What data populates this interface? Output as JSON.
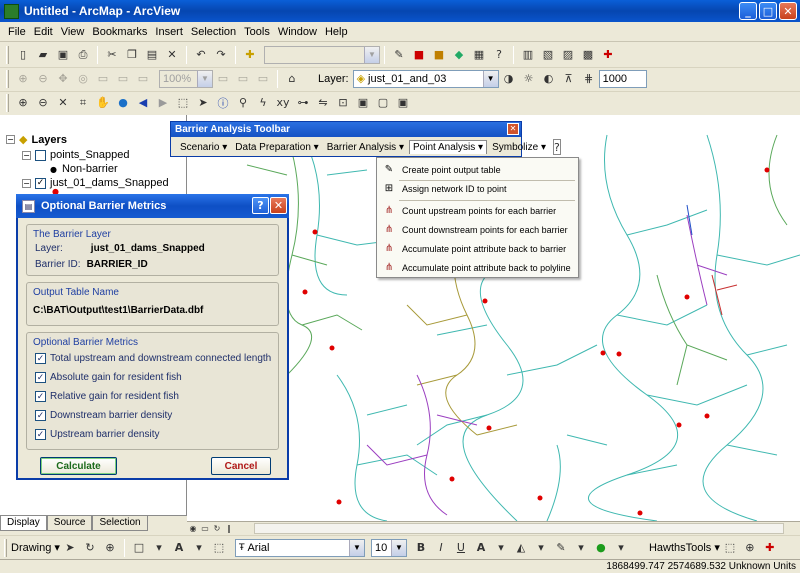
{
  "window": {
    "title": "Untitled - ArcMap - ArcView"
  },
  "menubar": [
    "File",
    "Edit",
    "View",
    "Bookmarks",
    "Insert",
    "Selection",
    "Tools",
    "Window",
    "Help"
  ],
  "toolbar2": {
    "zoom_value": "100%",
    "layer_label": "Layer:",
    "layer_value": "just_01_and_03",
    "scale_value": "1000"
  },
  "toc": {
    "root": "Layers",
    "layers": [
      {
        "name": "points_Snapped",
        "checked": false,
        "legend": "Non-barrier"
      },
      {
        "name": "just_01_dams_Snapped",
        "checked": true
      }
    ],
    "tabs": [
      "Display",
      "Source",
      "Selection"
    ]
  },
  "bat_toolbar": {
    "title": "Barrier Analysis Toolbar",
    "menus": [
      "Scenario",
      "Data Preparation",
      "Barrier Analysis",
      "Point Analysis",
      "Symbolize"
    ]
  },
  "point_menu": {
    "items": [
      {
        "label": "Create point output table",
        "icon": "pencil-icon"
      },
      {
        "label": "Assign network ID to point",
        "icon": "plus-point-icon"
      },
      {
        "label": "Count upstream points for each barrier",
        "icon": "network-icon"
      },
      {
        "label": "Count downstream points for each barrier",
        "icon": "network-icon"
      },
      {
        "label": "Accumulate point attribute back to barrier",
        "icon": "network-icon"
      },
      {
        "label": "Accumulate point attribute back to polyline",
        "icon": "network-icon"
      }
    ]
  },
  "dialog": {
    "title": "Optional Barrier Metrics",
    "barrier_group": "The Barrier Layer",
    "layer_label": "Layer:",
    "layer_value": "just_01_dams_Snapped",
    "barrier_id_label": "Barrier ID:",
    "barrier_id_value": "BARRIER_ID",
    "output_group": "Output Table Name",
    "output_path": "C:\\BAT\\Output\\test1\\BarrierData.dbf",
    "metrics_group": "Optional Barrier Metrics",
    "metrics": [
      "Total upstream and downstream connected length",
      "Absolute gain for resident fish",
      "Relative gain for resident fish",
      "Downstream barrier density",
      "Upstream barrier density"
    ],
    "calculate": "Calculate",
    "cancel": "Cancel"
  },
  "drawbar": {
    "drawing": "Drawing",
    "font": "Arial",
    "size": "10",
    "bold": "B",
    "italic": "I",
    "underline": "U",
    "hawths": "HawthsTools"
  },
  "status": {
    "coords": "1868499.747  2574689.532 Unknown Units"
  },
  "colors": {
    "title_blue": "#0a54cc",
    "river_cyan": "#3fb8b0",
    "river_green": "#5aa85a",
    "river_purple": "#9b3fc0",
    "river_olive": "#a89a3a",
    "dam_red": "#e00000"
  }
}
